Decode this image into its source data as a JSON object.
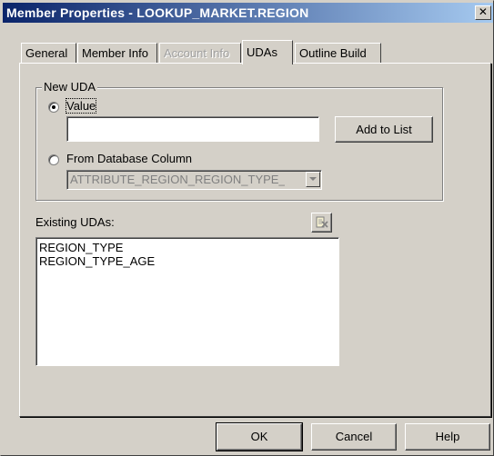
{
  "window": {
    "title": "Member Properties - LOOKUP_MARKET.REGION",
    "close_glyph": "✕"
  },
  "tabs": [
    {
      "label": "General",
      "state": "normal"
    },
    {
      "label": "Member Info",
      "state": "normal"
    },
    {
      "label": "Account Info",
      "state": "disabled"
    },
    {
      "label": "UDAs",
      "state": "active"
    },
    {
      "label": "Outline Build",
      "state": "normal"
    }
  ],
  "new_uda": {
    "group_label": "New UDA",
    "value_radio_label": "Value",
    "value_radio_checked": true,
    "value_input": "",
    "add_button_label": "Add to List",
    "db_column_radio_label": "From Database Column",
    "db_column_radio_checked": false,
    "db_column_select_value": "ATTRIBUTE_REGION_REGION_TYPE_"
  },
  "existing": {
    "label": "Existing UDAs:",
    "delete_icon": "delete-icon",
    "items": [
      "REGION_TYPE",
      "REGION_TYPE_AGE"
    ]
  },
  "footer": {
    "ok_label": "OK",
    "cancel_label": "Cancel",
    "help_label": "Help"
  }
}
